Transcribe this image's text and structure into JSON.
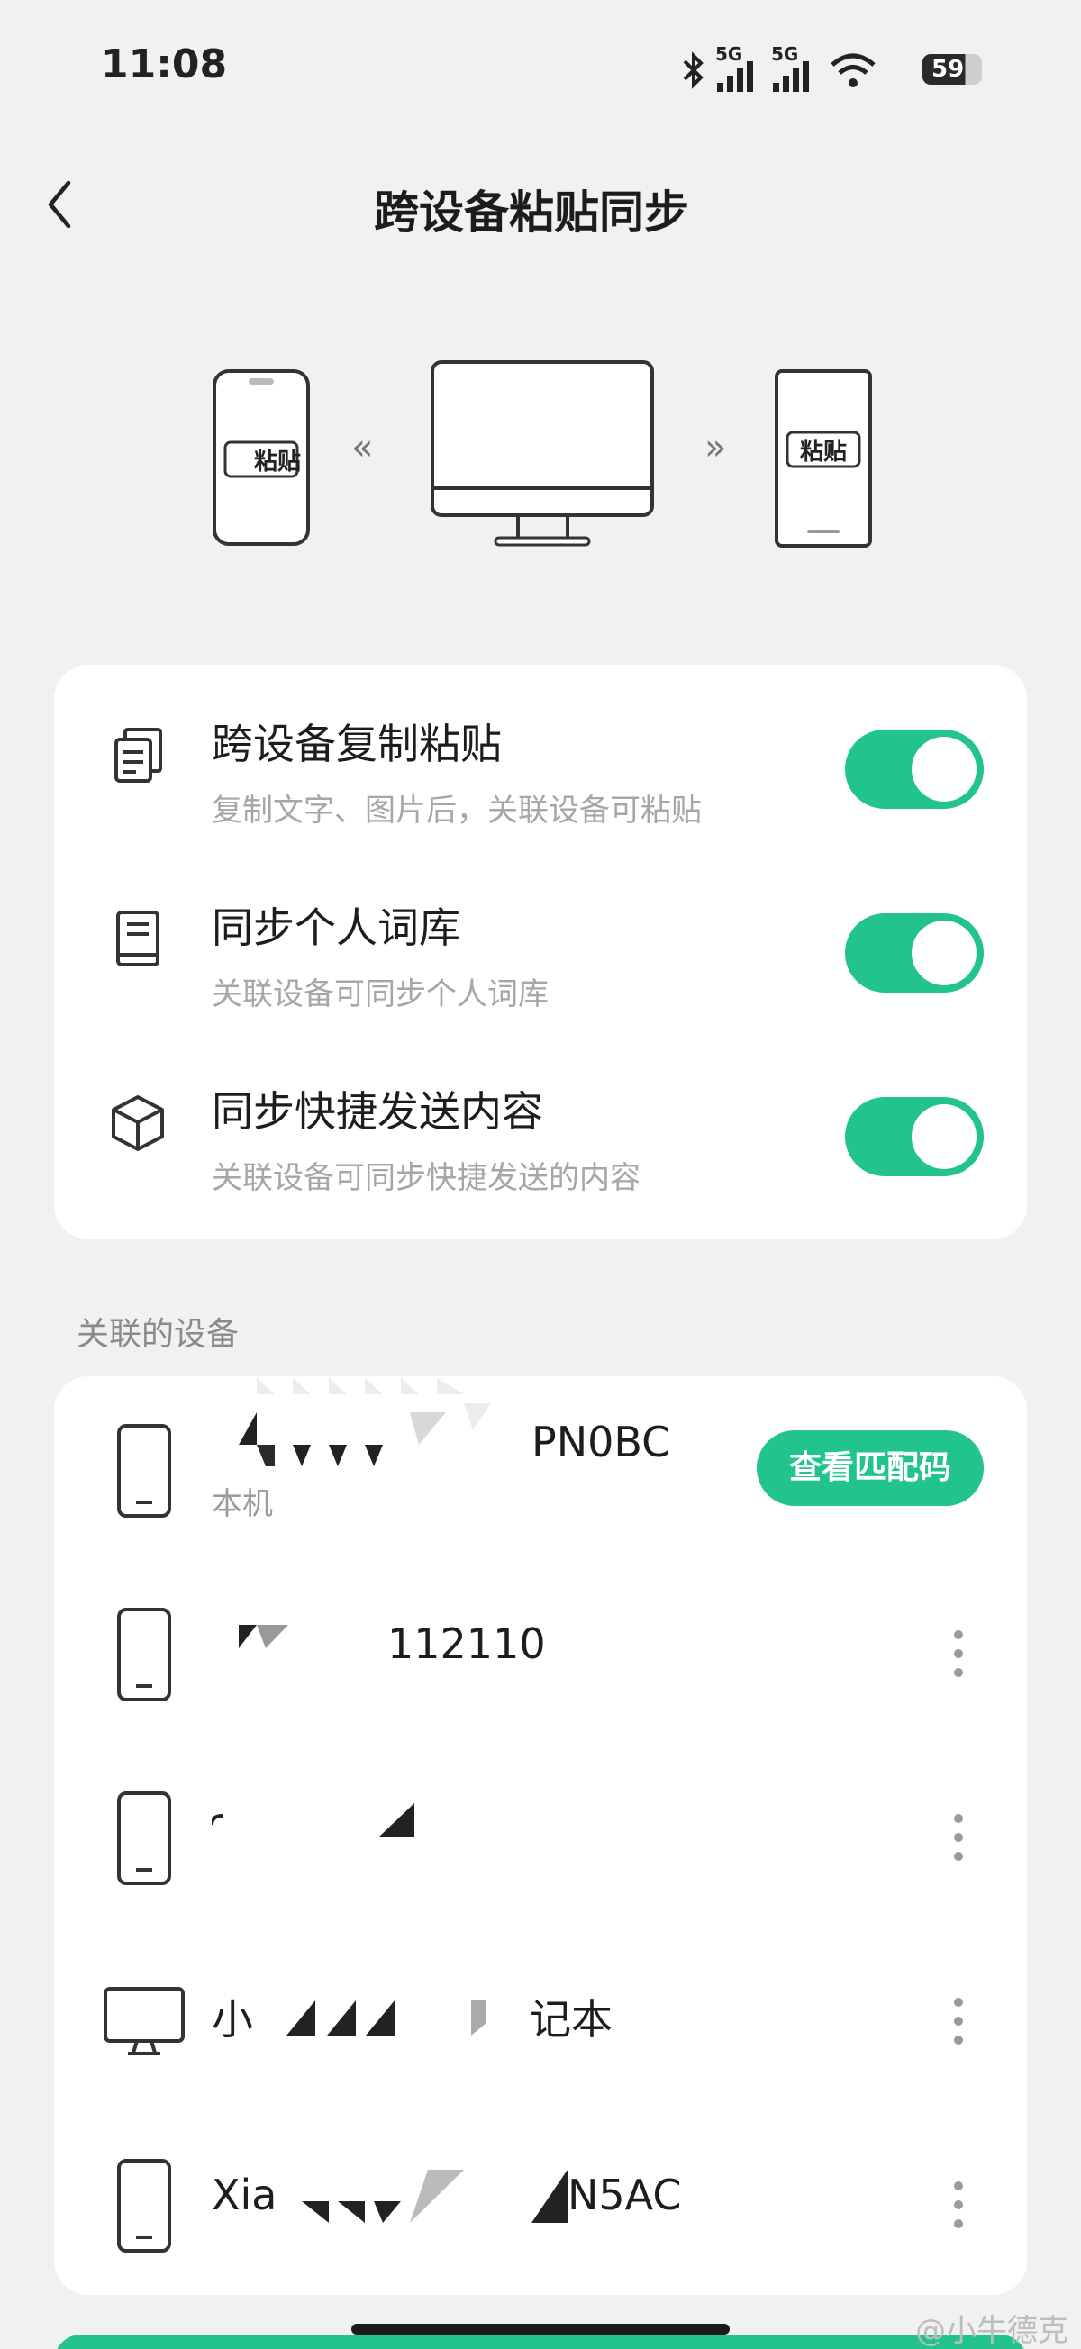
{
  "status_bar": {
    "time": "11:08",
    "network_1": "5G",
    "network_2": "5G",
    "battery": "59",
    "icons": [
      "bluetooth-icon",
      "signal-icon",
      "signal-icon",
      "wifi-icon",
      "battery-icon"
    ]
  },
  "header": {
    "title": "跨设备粘贴同步",
    "back_icon": "chevron-left-icon"
  },
  "illustration": {
    "left_phone_label": "粘贴",
    "right_phone_label": "粘贴",
    "left_arrow": "«",
    "right_arrow": "»"
  },
  "settings": [
    {
      "title": "跨设备复制粘贴",
      "subtitle": "复制文字、图片后，关联设备可粘贴",
      "icon": "copy-doc-icon",
      "enabled": true
    },
    {
      "title": "同步个人词库",
      "subtitle": "关联设备可同步个人词库",
      "icon": "book-icon",
      "enabled": true
    },
    {
      "title": "同步快捷发送内容",
      "subtitle": "关联设备可同步快捷发送的内容",
      "icon": "cube-icon",
      "enabled": true
    }
  ],
  "devices_section_label": "关联的设备",
  "devices": [
    {
      "name": "PN0BC",
      "subtitle": "本机",
      "type": "phone",
      "action": "查看匹配码"
    },
    {
      "name": "112110",
      "type": "phone",
      "action": "more"
    },
    {
      "name": "",
      "type": "phone",
      "action": "more"
    },
    {
      "name": "小",
      "name_suffix": "记本",
      "type": "desktop",
      "action": "more"
    },
    {
      "name": "Xia",
      "name_suffix": "N5AC",
      "type": "phone",
      "action": "more"
    }
  ],
  "watermark": "@小牛德克",
  "colors": {
    "accent": "#22c48c",
    "background": "#f1f1f1",
    "card": "#ffffff"
  }
}
